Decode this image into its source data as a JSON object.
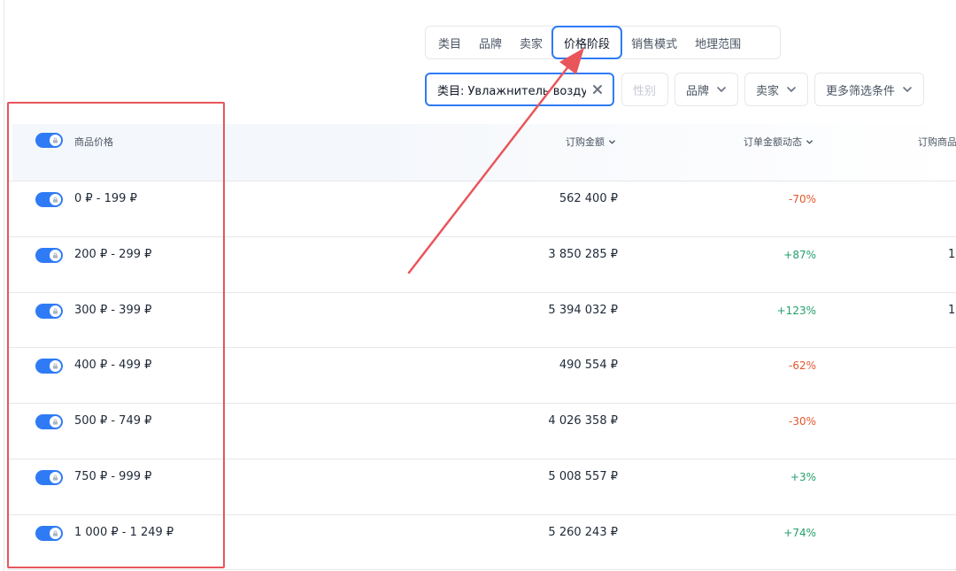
{
  "tabs": [
    {
      "label": "类目",
      "active": false
    },
    {
      "label": "品牌",
      "active": false
    },
    {
      "label": "卖家",
      "active": false
    },
    {
      "label": "价格阶段",
      "active": true
    },
    {
      "label": "销售模式",
      "active": false
    },
    {
      "label": "地理范围",
      "active": false
    }
  ],
  "filters": {
    "active_chip": "类目: Увлажнитель воздуха",
    "gender": "性别",
    "brand": "品牌",
    "seller": "卖家",
    "more": "更多筛选条件"
  },
  "table": {
    "columns": {
      "price": "商品价格",
      "order_amount": "订购金额",
      "order_amount_change": "订单金额动态",
      "order_goods": "订购商品"
    },
    "rows": [
      {
        "range": "0 ₽ - 199 ₽",
        "amount": "562 400 ₽",
        "change": "-70%",
        "trend": "down",
        "edge": ""
      },
      {
        "range": "200 ₽ - 299 ₽",
        "amount": "3 850 285 ₽",
        "change": "+87%",
        "trend": "up",
        "edge": "1"
      },
      {
        "range": "300 ₽ - 399 ₽",
        "amount": "5 394 032 ₽",
        "change": "+123%",
        "trend": "up",
        "edge": "1"
      },
      {
        "range": "400 ₽ - 499 ₽",
        "amount": "490 554 ₽",
        "change": "-62%",
        "trend": "down",
        "edge": ""
      },
      {
        "range": "500 ₽ - 749 ₽",
        "amount": "4 026 358 ₽",
        "change": "-30%",
        "trend": "down",
        "edge": ""
      },
      {
        "range": "750 ₽ - 999 ₽",
        "amount": "5 008 557 ₽",
        "change": "+3%",
        "trend": "up",
        "edge": ""
      },
      {
        "range": "1 000 ₽ - 1 249 ₽",
        "amount": "5 260 243 ₽",
        "change": "+74%",
        "trend": "up",
        "edge": ""
      }
    ]
  },
  "colors": {
    "accent": "#2f7bf5",
    "positive": "#22a06b",
    "negative": "#e4572e",
    "annotation": "#e8565b"
  },
  "icons": {
    "chip_close": "close-icon",
    "dropdown": "chevron-down-icon",
    "toggle_knob": "lock-icon"
  }
}
